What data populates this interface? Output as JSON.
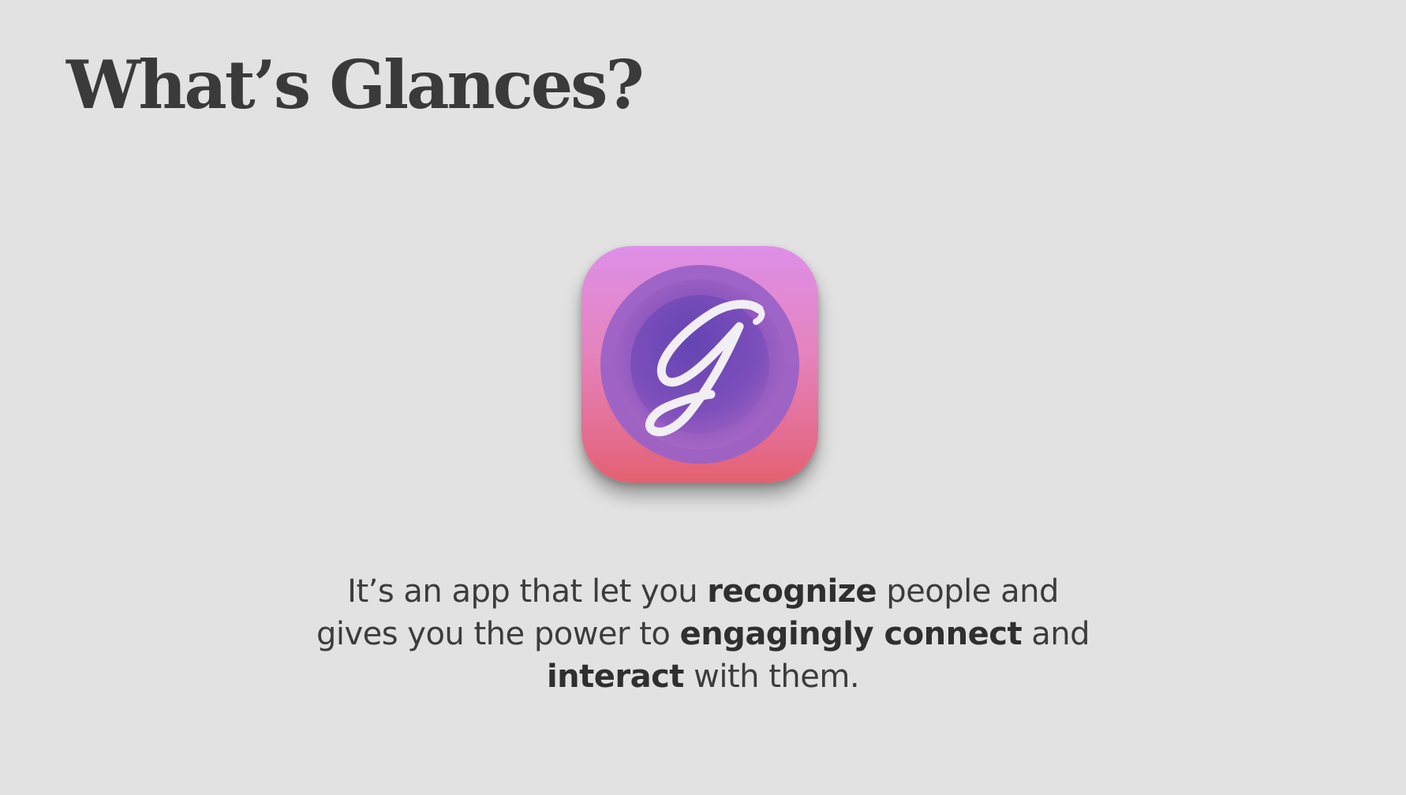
{
  "slide": {
    "title": "What’s Glances?"
  },
  "icon": {
    "name": "glances-app-icon",
    "letter": "g",
    "colors": {
      "top": "#de8fe8",
      "bottom": "#e3616f",
      "circle_outer": "#9a5dc4",
      "circle_inner": "#6a47b4",
      "letter": "#f1eef4"
    }
  },
  "description": {
    "line1_a": "It’s an app that let you ",
    "line1_b": "recognize",
    "line1_c": " people and",
    "line2_a": "gives you the power to ",
    "line2_b": "engagingly connect",
    "line2_c": " and",
    "line3_a": "interact",
    "line3_b": " with them."
  },
  "colors": {
    "background": "#e2e2e2",
    "text": "#3b3b3b"
  }
}
